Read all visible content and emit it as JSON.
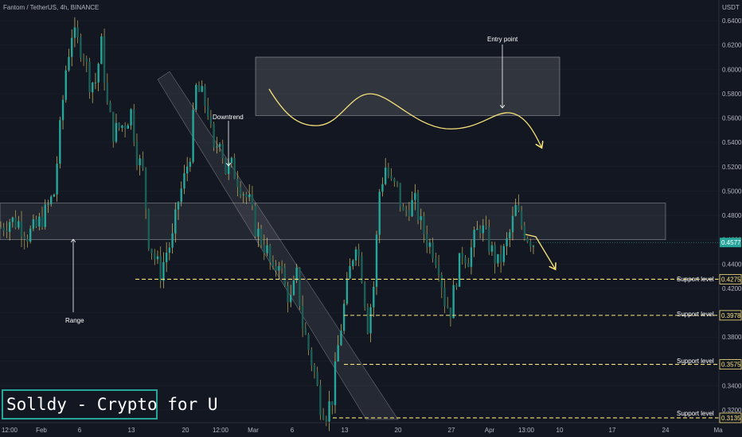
{
  "header": {
    "symbol": "Fantom / TetherUS, 4h, BINANCE",
    "currency": "USDT"
  },
  "watermark": "Solldy - Crypto for U",
  "colors": {
    "background": "#131722",
    "up": "#26a69a",
    "down": "#ef5350",
    "wick_accent": "#f7e27a",
    "support_line": "#f7e27a",
    "annotation": "#ffffff"
  },
  "chart_data": {
    "type": "candlestick",
    "ylim": [
      0.3,
      0.65
    ],
    "y_ticks": [
      "0.6400",
      "0.6200",
      "0.6000",
      "0.5800",
      "0.5600",
      "0.5400",
      "0.5200",
      "0.5000",
      "0.4800",
      "0.4600",
      "0.4400",
      "0.4200",
      "0.4000",
      "0.3800",
      "0.3600",
      "0.3400",
      "0.3200"
    ],
    "x_ticks": [
      "12:00",
      "Feb",
      "6",
      "13",
      "20",
      "12:00",
      "Mar",
      "6",
      "13",
      "20",
      "27",
      "Apr",
      "13:00",
      "10",
      "17",
      "24",
      "Ma"
    ],
    "price_levels": [
      {
        "label": "0.4577",
        "value": 0.4577,
        "kind": "last"
      },
      {
        "label": "0.4275",
        "value": 0.4275,
        "kind": "support"
      },
      {
        "label": "0.3978",
        "value": 0.3978,
        "kind": "support"
      },
      {
        "label": "0.3575",
        "value": 0.3575,
        "kind": "support"
      },
      {
        "label": "0.3135",
        "value": 0.3135,
        "kind": "support"
      }
    ],
    "support_labels": [
      "Support level",
      "Support level",
      "Support level",
      "Support level"
    ],
    "annotations": {
      "range": "Range",
      "downtrend": "Downtrend",
      "entry_point": "Entry point"
    },
    "range_zone": [
      0.46,
      0.49
    ],
    "entry_zone": [
      0.562,
      0.61
    ],
    "close_path": [
      [
        0,
        0.47
      ],
      [
        3,
        0.476
      ],
      [
        6,
        0.474
      ],
      [
        9,
        0.464
      ],
      [
        12,
        0.47
      ],
      [
        15,
        0.482
      ],
      [
        18,
        0.498
      ],
      [
        20,
        0.55
      ],
      [
        22,
        0.6
      ],
      [
        24,
        0.63
      ],
      [
        26,
        0.622
      ],
      [
        28,
        0.614
      ],
      [
        30,
        0.59
      ],
      [
        32,
        0.59
      ],
      [
        34,
        0.62
      ],
      [
        36,
        0.57
      ],
      [
        38,
        0.548
      ],
      [
        40,
        0.552
      ],
      [
        42,
        0.556
      ],
      [
        44,
        0.565
      ],
      [
        46,
        0.53
      ],
      [
        48,
        0.515
      ],
      [
        50,
        0.46
      ],
      [
        52,
        0.445
      ],
      [
        54,
        0.433
      ],
      [
        56,
        0.45
      ],
      [
        58,
        0.46
      ],
      [
        60,
        0.492
      ],
      [
        62,
        0.51
      ],
      [
        64,
        0.532
      ],
      [
        66,
        0.584
      ],
      [
        68,
        0.578
      ],
      [
        70,
        0.566
      ],
      [
        72,
        0.53
      ],
      [
        74,
        0.546
      ],
      [
        76,
        0.517
      ],
      [
        78,
        0.52
      ],
      [
        80,
        0.51
      ],
      [
        82,
        0.5
      ],
      [
        84,
        0.49
      ],
      [
        86,
        0.47
      ],
      [
        88,
        0.46
      ],
      [
        90,
        0.45
      ],
      [
        92,
        0.43
      ],
      [
        94,
        0.445
      ],
      [
        96,
        0.42
      ],
      [
        98,
        0.41
      ],
      [
        100,
        0.43
      ],
      [
        102,
        0.39
      ],
      [
        104,
        0.37
      ],
      [
        106,
        0.35
      ],
      [
        108,
        0.325
      ],
      [
        110,
        0.318
      ],
      [
        112,
        0.33
      ],
      [
        114,
        0.372
      ],
      [
        116,
        0.405
      ],
      [
        118,
        0.435
      ],
      [
        120,
        0.46
      ],
      [
        122,
        0.432
      ],
      [
        124,
        0.39
      ],
      [
        126,
        0.422
      ],
      [
        128,
        0.5
      ],
      [
        130,
        0.52
      ],
      [
        132,
        0.505
      ],
      [
        134,
        0.502
      ],
      [
        136,
        0.48
      ],
      [
        138,
        0.488
      ],
      [
        140,
        0.49
      ],
      [
        142,
        0.472
      ],
      [
        144,
        0.46
      ],
      [
        146,
        0.452
      ],
      [
        148,
        0.44
      ],
      [
        150,
        0.41
      ],
      [
        152,
        0.402
      ],
      [
        154,
        0.43
      ],
      [
        156,
        0.45
      ],
      [
        158,
        0.445
      ],
      [
        160,
        0.46
      ],
      [
        162,
        0.472
      ],
      [
        164,
        0.462
      ],
      [
        166,
        0.45
      ],
      [
        168,
        0.44
      ],
      [
        170,
        0.45
      ],
      [
        172,
        0.465
      ],
      [
        174,
        0.485
      ],
      [
        176,
        0.472
      ],
      [
        178,
        0.463
      ],
      [
        180,
        0.4577
      ]
    ]
  }
}
